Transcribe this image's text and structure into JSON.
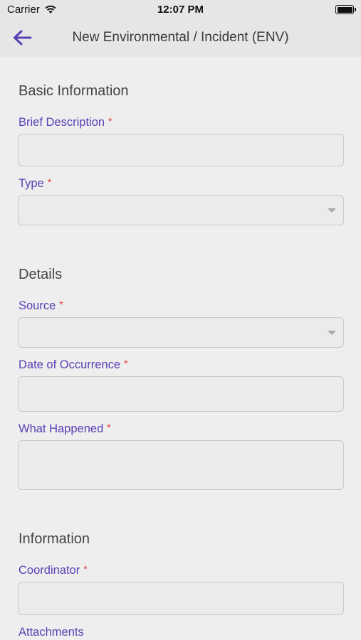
{
  "status_bar": {
    "carrier": "Carrier",
    "time": "12:07 PM"
  },
  "nav": {
    "title": "New Environmental / Incident (ENV)",
    "back_icon": "arrow-left-icon",
    "accent_color": "#5a3fb5"
  },
  "sections": {
    "basic": {
      "title": "Basic Information",
      "brief_description_label": "Brief Description",
      "type_label": "Type"
    },
    "details": {
      "title": "Details",
      "source_label": "Source",
      "date_label": "Date of Occurrence",
      "what_happened_label": "What Happened"
    },
    "information": {
      "title": "Information",
      "coordinator_label": "Coordinator",
      "attachments_label": "Attachments"
    }
  },
  "required_marker": "*",
  "colors": {
    "label": "#5a3fb5",
    "required": "#e03a3a",
    "background": "#eeeeee"
  }
}
